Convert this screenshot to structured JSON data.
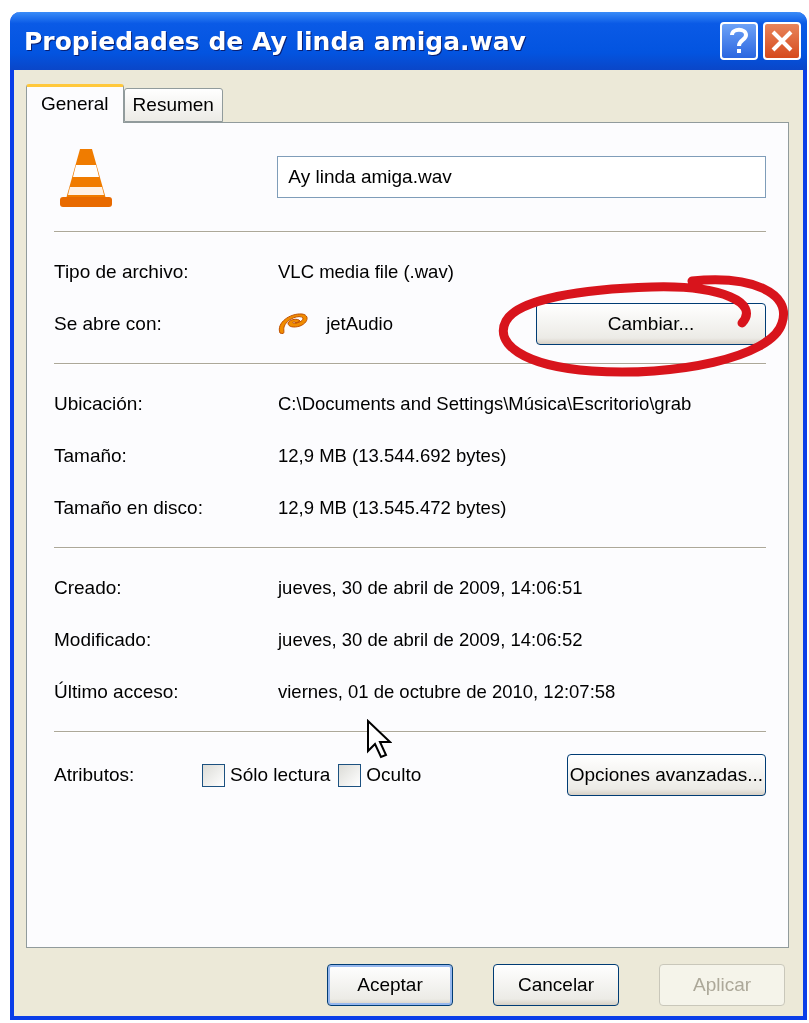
{
  "window": {
    "title": "Propiedades de Ay linda amiga.wav"
  },
  "tabs": [
    {
      "label": "General",
      "selected": true
    },
    {
      "label": "Resumen",
      "selected": false
    }
  ],
  "file_name": {
    "value": "Ay linda amiga.wav"
  },
  "sections": [
    {
      "rows": [
        {
          "kind": "text",
          "label": "Tipo de archivo:",
          "value": "VLC media file (.wav)"
        },
        {
          "kind": "app",
          "label": "Se abre con:",
          "value": "jetAudio",
          "button": "Cambiar..."
        }
      ]
    },
    {
      "rows": [
        {
          "kind": "text",
          "label": "Ubicación:",
          "value": "C:\\Documents and Settings\\Música\\Escritorio\\grab"
        },
        {
          "kind": "text",
          "label": "Tamaño:",
          "value": "12,9 MB (13.544.692 bytes)"
        },
        {
          "kind": "text",
          "label": "Tamaño en disco:",
          "value": "12,9 MB (13.545.472 bytes)"
        }
      ]
    },
    {
      "rows": [
        {
          "kind": "text",
          "label": "Creado:",
          "value": "jueves, 30 de abril de 2009, 14:06:51"
        },
        {
          "kind": "text",
          "label": "Modificado:",
          "value": "jueves, 30 de abril de 2009, 14:06:52"
        },
        {
          "kind": "text",
          "label": "Último acceso:",
          "value": "viernes, 01 de octubre de 2010, 12:07:58"
        }
      ]
    }
  ],
  "attributes": {
    "label": "Atributos:",
    "checkboxes": [
      {
        "label": "Sólo lectura",
        "checked": false
      },
      {
        "label": "Oculto",
        "checked": false
      }
    ],
    "button": "Opciones avanzadas..."
  },
  "buttons": [
    {
      "label": "Aceptar",
      "disabled": false,
      "default": true
    },
    {
      "label": "Cancelar",
      "disabled": false,
      "default": false
    },
    {
      "label": "Aplicar",
      "disabled": true,
      "default": false
    }
  ]
}
